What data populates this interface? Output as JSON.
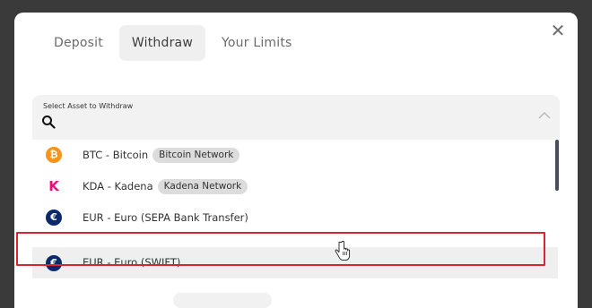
{
  "tabs": [
    {
      "label": "Deposit",
      "active": false
    },
    {
      "label": "Withdraw",
      "active": true
    },
    {
      "label": "Your Limits",
      "active": false
    }
  ],
  "close_icon": "close-icon",
  "asset_select": {
    "label": "Select Asset to Withdraw",
    "search_value": "",
    "expanded": true
  },
  "assets": [
    {
      "name": "BTC - Bitcoin",
      "network": "Bitcoin Network",
      "icon": "bitcoin-icon",
      "icon_color": "#f7931a",
      "icon_glyph": "₿"
    },
    {
      "name": "KDA - Kadena",
      "network": "Kadena Network",
      "icon": "kadena-icon",
      "icon_color": "#e5107a",
      "icon_glyph": "K"
    },
    {
      "name": "EUR - Euro (SEPA Bank Transfer)",
      "network": "",
      "icon": "euro-icon",
      "icon_color": "#0c2a6b",
      "icon_glyph": "€"
    },
    {
      "name": "EUR - Euro (SWIFT)",
      "network": "",
      "icon": "euro-icon",
      "icon_color": "#0c2a6b",
      "icon_glyph": "€"
    }
  ],
  "hovered_asset_index": 3,
  "highlight_color": "#d9252f"
}
